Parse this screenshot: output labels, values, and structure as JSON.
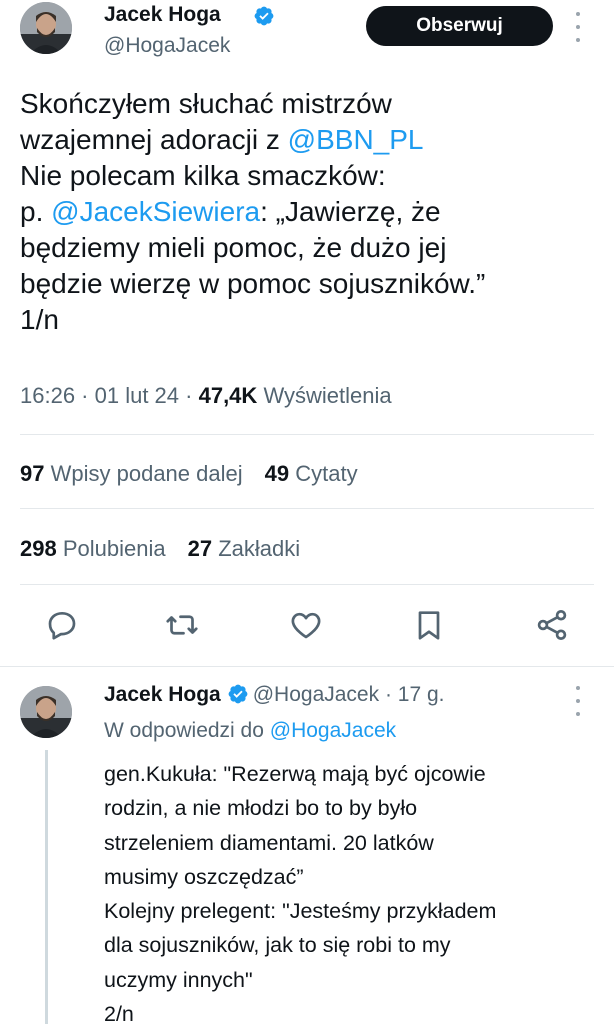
{
  "main_tweet": {
    "author": {
      "name": "Jacek Hoga",
      "handle": "@HogaJacek"
    },
    "follow_label": "Obserwuj",
    "text_lines": [
      {
        "before": "Skończyłem słuchać mistrzów",
        "mention": "",
        "after": ""
      },
      {
        "before": "wzajemnej adoracji z ",
        "mention": "@BBN_PL",
        "after": ""
      },
      {
        "before": "Nie polecam kilka smaczków:",
        "mention": "",
        "after": ""
      },
      {
        "before": "p. ",
        "mention": "@JacekSiewiera",
        "after": ": „Jawierzę, że"
      },
      {
        "before": "będziemy mieli pomoc, że dużo jej",
        "mention": "",
        "after": ""
      },
      {
        "before": "będzie wierzę w pomoc sojuszników.”",
        "mention": "",
        "after": ""
      },
      {
        "before": "1/n",
        "mention": "",
        "after": ""
      }
    ],
    "time": "16:26",
    "date": "01 lut 24",
    "views_count": "47,4K",
    "views_label": "Wyświetlenia",
    "reposts_count": "97",
    "reposts_label": "Wpisy podane dalej",
    "quotes_count": "49",
    "quotes_label": "Cytaty",
    "likes_count": "298",
    "likes_label": "Polubienia",
    "bookmarks_count": "27",
    "bookmarks_label": "Zakładki",
    "actions": [
      "reply-icon",
      "repost-icon",
      "like-icon",
      "bookmark-icon",
      "share-icon"
    ]
  },
  "reply_tweet": {
    "author": {
      "name": "Jacek Hoga",
      "handle": "@HogaJacek"
    },
    "age": "17 g.",
    "replying_to_label": "W odpowiedzi do",
    "replying_to_handle": "@HogaJacek",
    "text_lines": [
      "gen.Kukuła: \"Rezerwą mają być ojcowie",
      "rodzin, a nie młodzi bo to by było",
      "strzeleniem diamentami. 20 latków",
      "musimy oszczędzać”",
      "Kolejny prelegent: \"Jesteśmy przykładem",
      "dla sojuszników, jak to się robi to my",
      "uczymy innych\"",
      "2/n"
    ]
  },
  "colors": {
    "link": "#1d9bf0",
    "secondary_text": "#536471",
    "primary_text": "#0f1419",
    "verified": "#1d9bf0",
    "follow_button": "#0f1419",
    "icon": "#536471"
  }
}
